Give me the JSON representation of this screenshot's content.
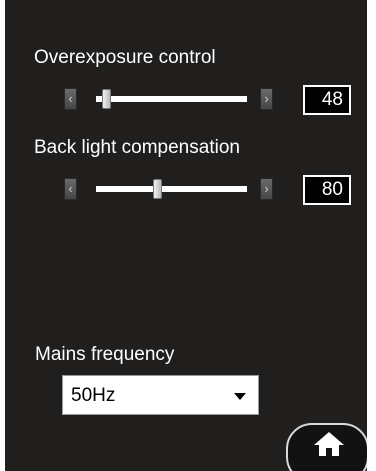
{
  "controls": {
    "overexposure": {
      "label": "Overexposure control",
      "value": "48",
      "slider_fraction": 0.04
    },
    "backlight": {
      "label": "Back light compensation",
      "value": "80",
      "slider_fraction": 0.4
    },
    "mains": {
      "label": "Mains frequency",
      "selected": "50Hz"
    }
  },
  "icons": {
    "step_left": "‹",
    "step_right": "›",
    "home": "home-icon",
    "dropdown": "chevron-down-icon"
  },
  "colors": {
    "panel_background": "#201f1e",
    "text": "#ffffff",
    "value_box": "#000000"
  }
}
